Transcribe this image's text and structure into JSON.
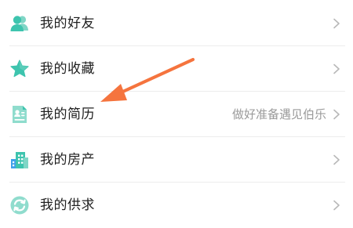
{
  "menu": {
    "items": [
      {
        "label": "我的好友",
        "hint": "",
        "icon": "friends-icon"
      },
      {
        "label": "我的收藏",
        "hint": "",
        "icon": "star-icon"
      },
      {
        "label": "我的简历",
        "hint": "做好准备遇见伯乐",
        "icon": "resume-icon"
      },
      {
        "label": "我的房产",
        "hint": "",
        "icon": "building-icon"
      },
      {
        "label": "我的供求",
        "hint": "",
        "icon": "exchange-icon"
      }
    ]
  },
  "colors": {
    "icon_teal": "#3ec4ae",
    "icon_blue": "#3fa1ea",
    "arrow": "#f5743e",
    "chevron": "#b8b8b8"
  }
}
